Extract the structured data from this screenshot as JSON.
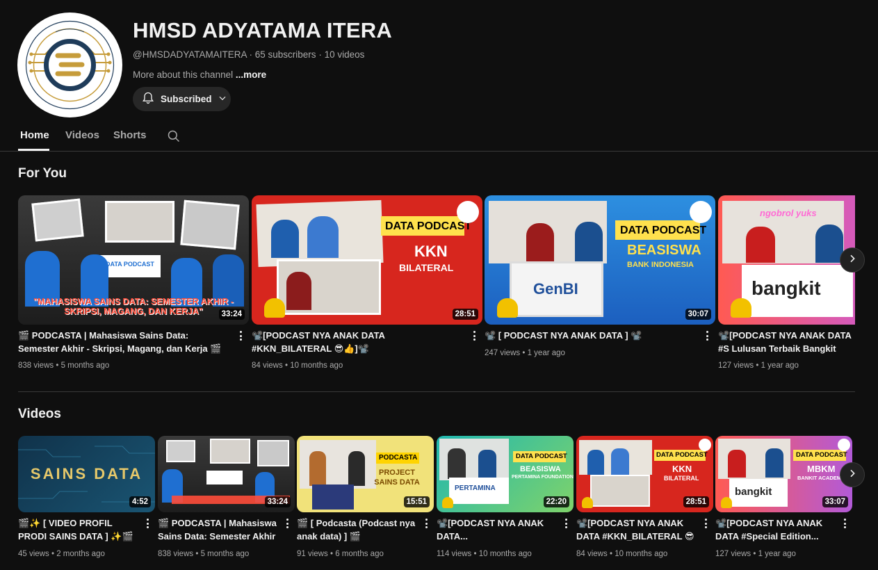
{
  "channel": {
    "name": "HMSD ADYATAMA ITERA",
    "handle": "@HMSDADYATAMAITERA",
    "subscribers": "65 subscribers",
    "videos_count": "10 videos",
    "about": "More about this channel",
    "more": "...more",
    "subscribe_label": "Subscribed"
  },
  "tabs": [
    {
      "label": "Home"
    },
    {
      "label": "Videos"
    },
    {
      "label": "Shorts"
    }
  ],
  "sections": {
    "for_you": "For You",
    "videos": "Videos"
  },
  "for_you": [
    {
      "title": "🎬 PODCASTA | Mahasiswa Sains Data: Semester Akhir - Skripsi, Magang, dan Kerja 🎬",
      "views": "838 views",
      "age": "5 months ago",
      "duration": "33:24",
      "thumb_caption": "\"MAHASISWA SAINS DATA: SEMESTER AKHIR - SKRIPSI, MAGANG, DAN KERJA\"",
      "thumb_label": "DATA PODCAST"
    },
    {
      "title": "📽️[PODCAST NYA ANAK DATA #KKN_BILATERAL 😎👍]📽️",
      "views": "84 views",
      "age": "10 months ago",
      "duration": "28:51",
      "thumb_heading": "DATA PODCAST",
      "thumb_main": "KKN",
      "thumb_sub": "BILATERAL"
    },
    {
      "title": "📽️ [ PODCAST NYA ANAK DATA ] 📽️",
      "views": "247 views",
      "age": "1 year ago",
      "duration": "30:07",
      "thumb_heading": "DATA PODCAST",
      "thumb_main": "BEASISWA",
      "thumb_sub": "BANK INDONESIA",
      "thumb_logo": "GenBI"
    },
    {
      "title": "📽️[PODCAST NYA ANAK DATA #S Lulusan Terbaik Bangkit Academy",
      "views": "127 views",
      "age": "1 year ago",
      "thumb_logo": "bangkit",
      "thumb_neon": "ngobrol yuks"
    }
  ],
  "videos": [
    {
      "title": "🎬✨ [ VIDEO PROFIL PRODI SAINS DATA ] ✨🎬",
      "views": "45 views",
      "age": "2 months ago",
      "duration": "4:52",
      "thumb_text": "SAINS DATA"
    },
    {
      "title": "🎬 PODCASTA | Mahasiswa Sains Data: Semester Akhir ...",
      "views": "838 views",
      "age": "5 months ago",
      "duration": "33:24"
    },
    {
      "title": "🎬 [ Podcasta (Podcast nya anak data) ] 🎬",
      "views": "91 views",
      "age": "6 months ago",
      "duration": "15:51",
      "thumb_tag": "PODCASTA",
      "thumb_main": "PROJECT SAINS DATA"
    },
    {
      "title": "📽️[PODCAST NYA ANAK DATA...",
      "views": "114 views",
      "age": "10 months ago",
      "duration": "22:20",
      "thumb_heading": "DATA PODCAST",
      "thumb_main": "BEASISWA",
      "thumb_sub": "PERTAMINA FOUNDATION",
      "thumb_logo": "PERTAMINA"
    },
    {
      "title": "📽️[PODCAST NYA ANAK DATA #KKN_BILATERAL 😎 ...",
      "views": "84 views",
      "age": "10 months ago",
      "duration": "28:51",
      "thumb_heading": "DATA PODCAST",
      "thumb_main": "KKN",
      "thumb_sub": "BILATERAL"
    },
    {
      "title": "📽️[PODCAST NYA ANAK DATA #Special Edition...",
      "views": "127 views",
      "age": "1 year ago",
      "duration": "33:07",
      "thumb_heading": "DATA PODCAST",
      "thumb_main": "MBKM",
      "thumb_sub": "BANKIT ACADEMY",
      "thumb_logo": "bangkit"
    }
  ],
  "colors": {
    "background": "#0f0f0f",
    "text": "#f1f1f1",
    "secondary": "#aaaaaa",
    "chip": "#272727",
    "accent_red": "#d7261e",
    "accent_blue": "#1f6fd1",
    "accent_yellow": "#ffe14d"
  }
}
